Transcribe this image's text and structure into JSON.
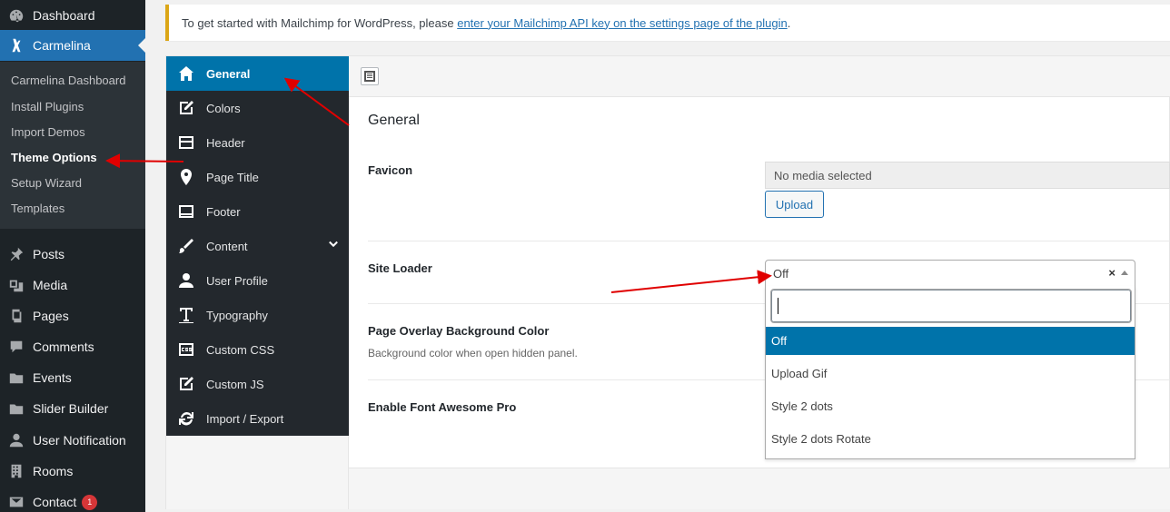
{
  "admin_menu": {
    "items_top": [
      {
        "label": "Dashboard",
        "icon": "dashboard-icon"
      },
      {
        "label": "Carmelina",
        "icon": "carmelina-icon"
      }
    ],
    "submenu": [
      {
        "label": "Carmelina Dashboard"
      },
      {
        "label": "Install Plugins"
      },
      {
        "label": "Import Demos"
      },
      {
        "label": "Theme Options"
      },
      {
        "label": "Setup Wizard"
      },
      {
        "label": "Templates"
      }
    ],
    "items_bottom": [
      {
        "label": "Posts",
        "icon": "pushpin-icon"
      },
      {
        "label": "Media",
        "icon": "media-icon"
      },
      {
        "label": "Pages",
        "icon": "pages-icon"
      },
      {
        "label": "Comments",
        "icon": "comment-icon"
      },
      {
        "label": "Events",
        "icon": "folder-icon"
      },
      {
        "label": "Slider Builder",
        "icon": "folder-icon"
      },
      {
        "label": "User Notification",
        "icon": "user-icon"
      },
      {
        "label": "Rooms",
        "icon": "building-icon"
      },
      {
        "label": "Contact",
        "icon": "mail-icon",
        "badge": "1"
      }
    ]
  },
  "notice": {
    "text": "To get started with Mailchimp for WordPress, please ",
    "link": "enter your Mailchimp API key on the settings page of the plugin",
    "end": "."
  },
  "options_nav": [
    {
      "label": "General",
      "icon": "home-icon"
    },
    {
      "label": "Colors",
      "icon": "edit-icon"
    },
    {
      "label": "Header",
      "icon": "layout-icon"
    },
    {
      "label": "Page Title",
      "icon": "location-pin-icon"
    },
    {
      "label": "Footer",
      "icon": "layout-icon"
    },
    {
      "label": "Content",
      "icon": "brush-icon"
    },
    {
      "label": "User Profile",
      "icon": "user-icon"
    },
    {
      "label": "Typography",
      "icon": "text-icon"
    },
    {
      "label": "Custom CSS",
      "icon": "css-icon"
    },
    {
      "label": "Custom JS",
      "icon": "edit-icon"
    },
    {
      "label": "Import / Export",
      "icon": "refresh-icon"
    }
  ],
  "section": {
    "title": "General",
    "favicon": {
      "label": "Favicon",
      "value": "No media selected",
      "button": "Upload"
    },
    "site_loader": {
      "label": "Site Loader",
      "selected": "Off",
      "clear": "×",
      "search_value": "",
      "options": [
        "Off",
        "Upload Gif",
        "Style 2 dots",
        "Style 2 dots Rotate"
      ]
    },
    "overlay": {
      "label": "Page Overlay Background Color",
      "desc": "Background color when open hidden panel."
    },
    "font_awesome": {
      "label": "Enable Font Awesome Pro"
    }
  },
  "colors": {
    "admin_bg": "#1d2327",
    "admin_accent": "#2271b1",
    "nav_bg": "#23282d",
    "nav_active": "#0073aa",
    "annotation": "#e00000"
  }
}
